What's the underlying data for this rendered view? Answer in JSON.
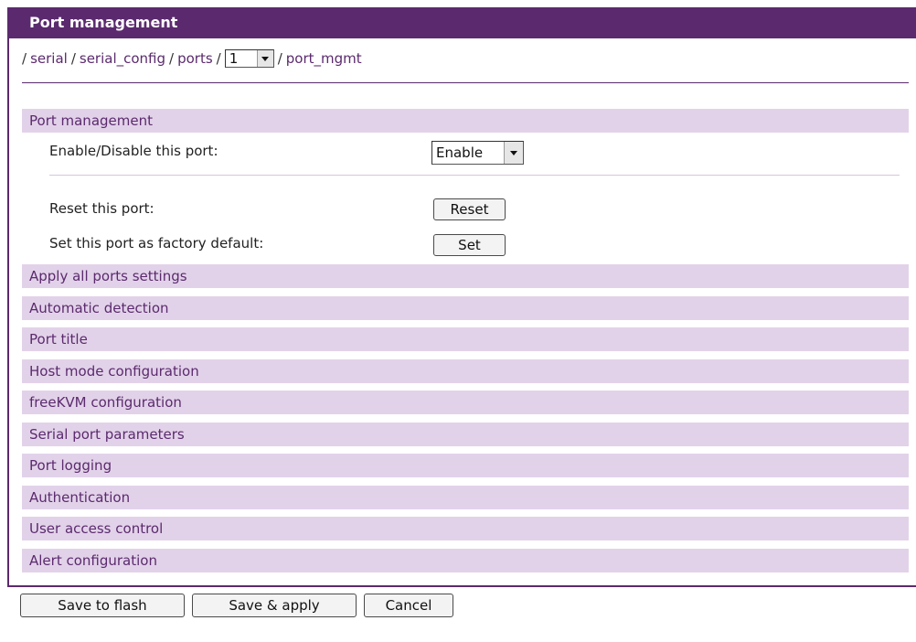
{
  "title": "Port management",
  "breadcrumb": {
    "serial": "serial",
    "serial_config": "serial_config",
    "ports": "ports",
    "port_number": "1",
    "port_mgmt": "port_mgmt",
    "separator": "/"
  },
  "port_management": {
    "header": "Port management",
    "enable_label": "Enable/Disable this port:",
    "enable_value": "Enable",
    "reset_label": "Reset this port:",
    "reset_button": "Reset",
    "factory_label": "Set this port as factory default:",
    "set_button": "Set"
  },
  "sections": [
    "Apply all ports settings",
    "Automatic detection",
    "Port title",
    "Host mode configuration",
    "freeKVM configuration",
    "Serial port parameters",
    "Port logging",
    "Authentication",
    "User access control",
    "Alert configuration"
  ],
  "footer": {
    "save_flash": "Save to flash",
    "save_apply": "Save & apply",
    "cancel": "Cancel"
  },
  "colors": {
    "accent": "#5b2a6e",
    "section_bg": "#e2d2e9"
  }
}
